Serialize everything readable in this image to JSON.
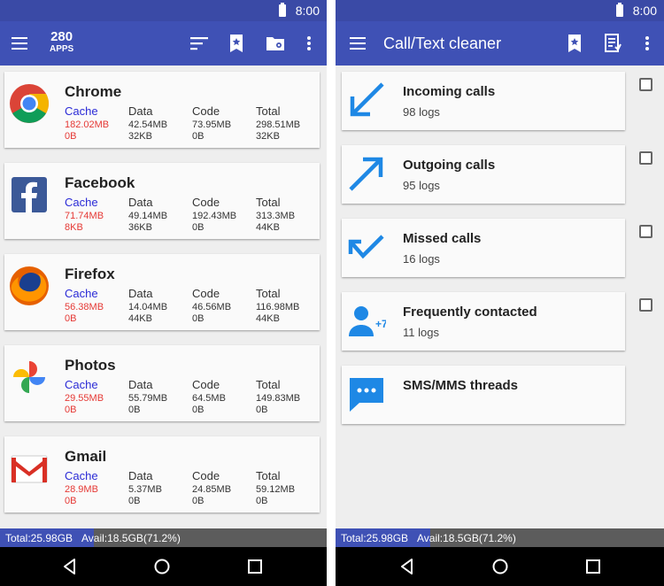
{
  "status_time": "8:00",
  "left": {
    "app_count": "280",
    "app_count_label": "APPS",
    "apps": [
      {
        "name": "Chrome",
        "cache": [
          "182.02MB",
          "0B"
        ],
        "data": [
          "42.54MB",
          "32KB"
        ],
        "code": [
          "73.95MB",
          "0B"
        ],
        "total": [
          "298.51MB",
          "32KB"
        ]
      },
      {
        "name": "Facebook",
        "cache": [
          "71.74MB",
          "8KB"
        ],
        "data": [
          "49.14MB",
          "36KB"
        ],
        "code": [
          "192.43MB",
          "0B"
        ],
        "total": [
          "313.3MB",
          "44KB"
        ]
      },
      {
        "name": "Firefox",
        "cache": [
          "56.38MB",
          "0B"
        ],
        "data": [
          "14.04MB",
          "44KB"
        ],
        "code": [
          "46.56MB",
          "0B"
        ],
        "total": [
          "116.98MB",
          "44KB"
        ]
      },
      {
        "name": "Photos",
        "cache": [
          "29.55MB",
          "0B"
        ],
        "data": [
          "55.79MB",
          "0B"
        ],
        "code": [
          "64.5MB",
          "0B"
        ],
        "total": [
          "149.83MB",
          "0B"
        ]
      },
      {
        "name": "Gmail",
        "cache": [
          "28.9MB",
          "0B"
        ],
        "data": [
          "5.37MB",
          "0B"
        ],
        "code": [
          "24.85MB",
          "0B"
        ],
        "total": [
          "59.12MB",
          "0B"
        ]
      }
    ],
    "col_labels": {
      "cache": "Cache",
      "data": "Data",
      "code": "Code",
      "total": "Total"
    }
  },
  "right": {
    "title": "Call/Text cleaner",
    "items": [
      {
        "title": "Incoming calls",
        "sub": "98 logs",
        "icon": "incoming-arrow-icon"
      },
      {
        "title": "Outgoing calls",
        "sub": "95 logs",
        "icon": "outgoing-arrow-icon"
      },
      {
        "title": "Missed calls",
        "sub": "16 logs",
        "icon": "missed-call-icon"
      },
      {
        "title": "Frequently contacted",
        "sub": "11 logs",
        "icon": "contact-plus-icon",
        "badge": "+7"
      },
      {
        "title": "SMS/MMS threads",
        "sub": "",
        "icon": "message-icon"
      }
    ]
  },
  "storage": {
    "total": "Total:25.98GB",
    "avail": "Avail:18.5GB(71.2%)",
    "used_fraction": 0.288
  },
  "colors": {
    "primary": "#3f51b5",
    "status": "#3a4aa6",
    "accent_blue": "#1e88e5",
    "cache_label": "#2b2bd6",
    "cache_value": "#e53935"
  }
}
